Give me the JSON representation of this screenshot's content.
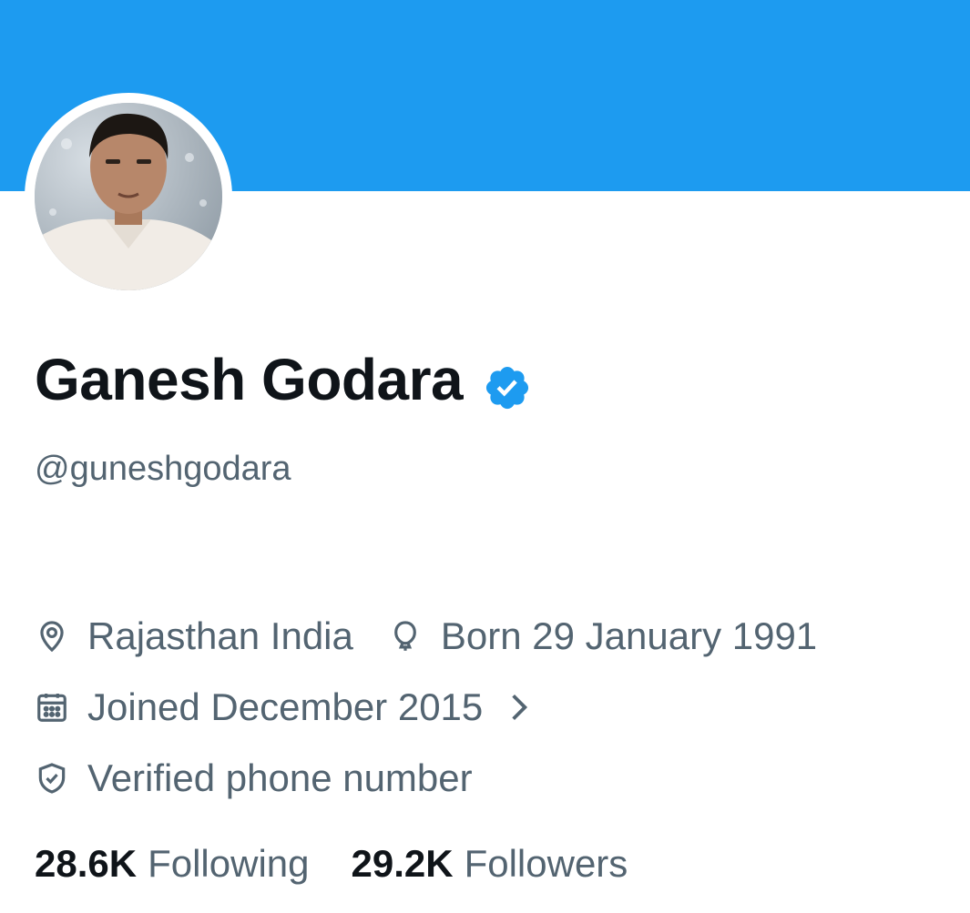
{
  "colors": {
    "banner": "#1d9bf0",
    "verified": "#1d9bf0",
    "primary_text": "#0f1419",
    "secondary_text": "#536471"
  },
  "profile": {
    "display_name": "Ganesh Godara",
    "handle": "@guneshgodara",
    "verified_icon": "verified-badge-icon"
  },
  "details": {
    "location": {
      "icon": "location-pin-icon",
      "text": "Rajasthan India"
    },
    "birthday": {
      "icon": "balloon-icon",
      "text": "Born 29 January 1991"
    },
    "joined": {
      "icon": "calendar-icon",
      "text": "Joined December 2015"
    },
    "verified_phone": {
      "icon": "shield-check-icon",
      "text": "Verified phone number"
    }
  },
  "stats": {
    "following": {
      "count": "28.6K",
      "label": "Following"
    },
    "followers": {
      "count": "29.2K",
      "label": "Followers"
    }
  }
}
